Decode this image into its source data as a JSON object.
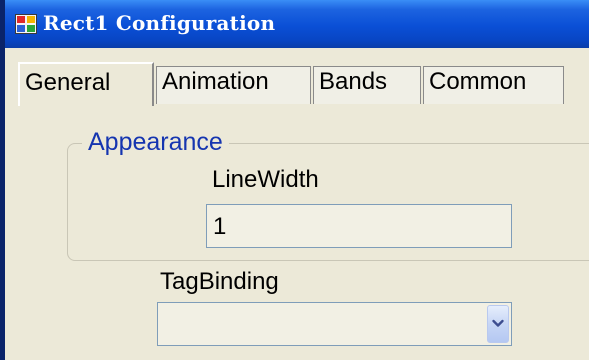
{
  "window": {
    "title": "Rect1 Configuration",
    "icon": "app-window-icon"
  },
  "tabs": [
    {
      "label": "General",
      "active": true
    },
    {
      "label": "Animation",
      "active": false
    },
    {
      "label": "Bands",
      "active": false
    },
    {
      "label": "Common",
      "active": false
    }
  ],
  "appearance": {
    "group_label": "Appearance",
    "line_width_label": "LineWidth",
    "line_width_value": "1"
  },
  "tag_binding": {
    "label": "TagBinding",
    "selected_value": "",
    "dropdown_icon": "chevron-down-icon"
  },
  "colors": {
    "title_bar": "#0a4fd6",
    "dialog_background": "#ece9d8",
    "group_label": "#1535b0"
  }
}
